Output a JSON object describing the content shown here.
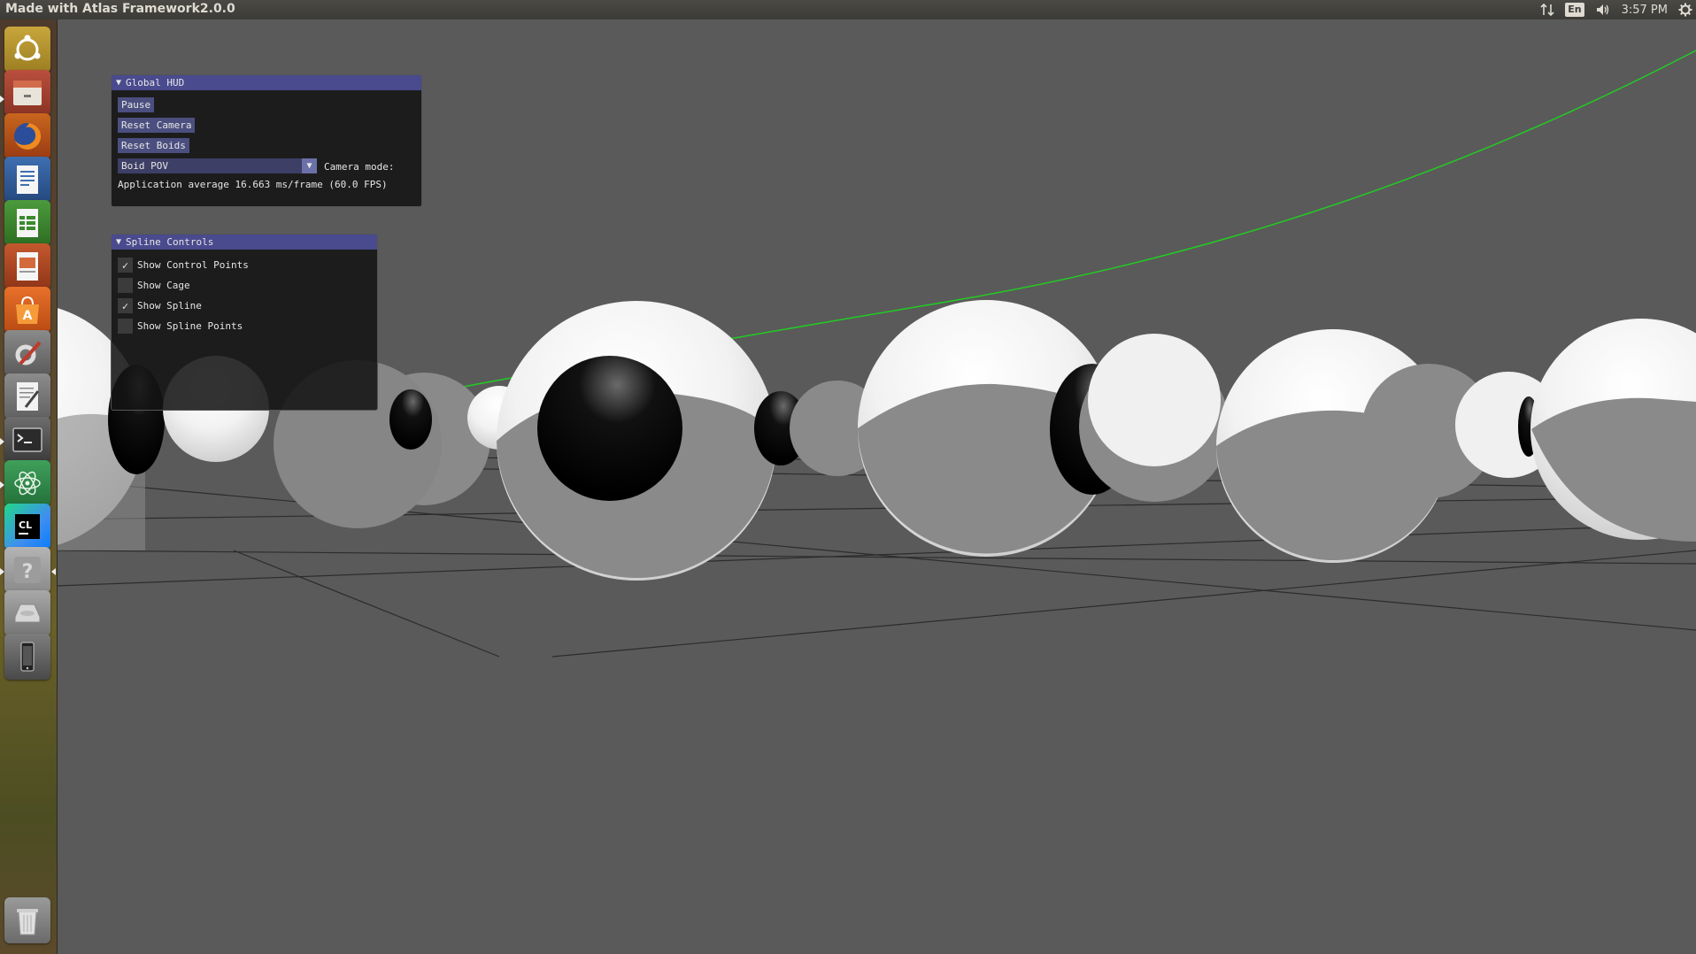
{
  "topbar": {
    "app_title": "Made with Atlas Framework2.0.0",
    "language": "En",
    "clock": "3:57 PM"
  },
  "launcher": {
    "items": [
      {
        "name": "ubuntu-dash-icon"
      },
      {
        "name": "files-icon"
      },
      {
        "name": "firefox-icon"
      },
      {
        "name": "writer-icon"
      },
      {
        "name": "calc-icon"
      },
      {
        "name": "impress-icon"
      },
      {
        "name": "software-center-icon"
      },
      {
        "name": "settings-icon"
      },
      {
        "name": "text-editor-icon"
      },
      {
        "name": "terminal-icon"
      },
      {
        "name": "atom-icon"
      },
      {
        "name": "clion-icon"
      },
      {
        "name": "help-icon"
      },
      {
        "name": "drive-icon"
      },
      {
        "name": "phone-icon"
      },
      {
        "name": "trash-icon"
      }
    ]
  },
  "global_hud": {
    "title": "Global HUD",
    "pause_label": "Pause",
    "reset_camera_label": "Reset Camera",
    "reset_boids_label": "Reset Boids",
    "camera_mode_value": "Boid POV",
    "camera_mode_label": "Camera mode:",
    "stats": "Application average 16.663 ms/frame (60.0 FPS)"
  },
  "spline_controls": {
    "title": "Spline Controls",
    "options": [
      {
        "label": "Show Control Points",
        "checked": true
      },
      {
        "label": "Show Cage",
        "checked": false
      },
      {
        "label": "Show Spline",
        "checked": true
      },
      {
        "label": "Show Spline Points",
        "checked": false
      }
    ]
  },
  "colors": {
    "hud_title": "#4a4a8e",
    "button": "#4b4f7f",
    "spline": "#22cc22",
    "background": "#5a5a5a"
  }
}
